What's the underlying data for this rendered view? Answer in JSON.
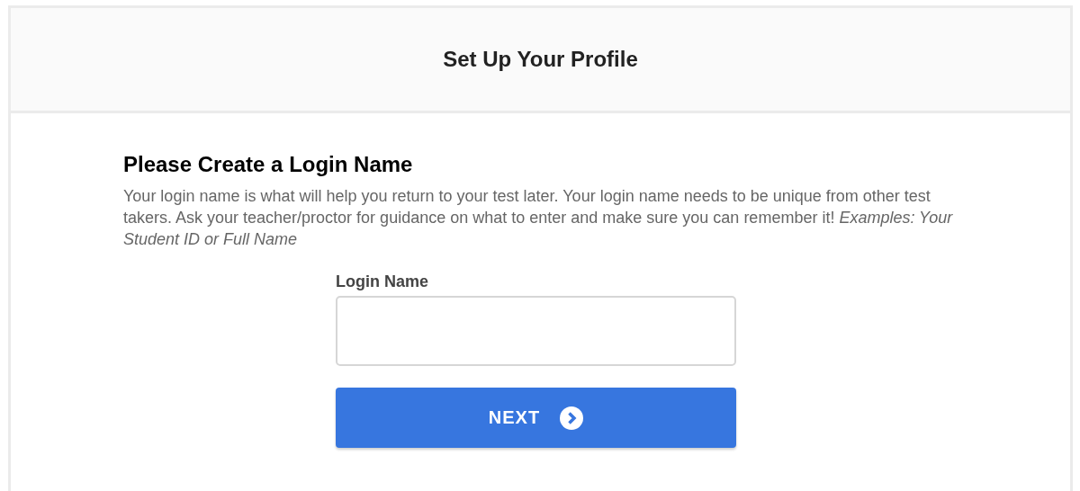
{
  "header": {
    "title": "Set Up Your Profile"
  },
  "section": {
    "heading": "Please Create a Login Name",
    "description": "Your login name is what will help you return to your test later. Your login name needs to be unique from other test takers. Ask your teacher/proctor for guidance on what to enter and make sure you can remember it! *Examples: Your Student ID or Full Name*"
  },
  "form": {
    "label": "Login Name",
    "button": "NEXT"
  }
}
